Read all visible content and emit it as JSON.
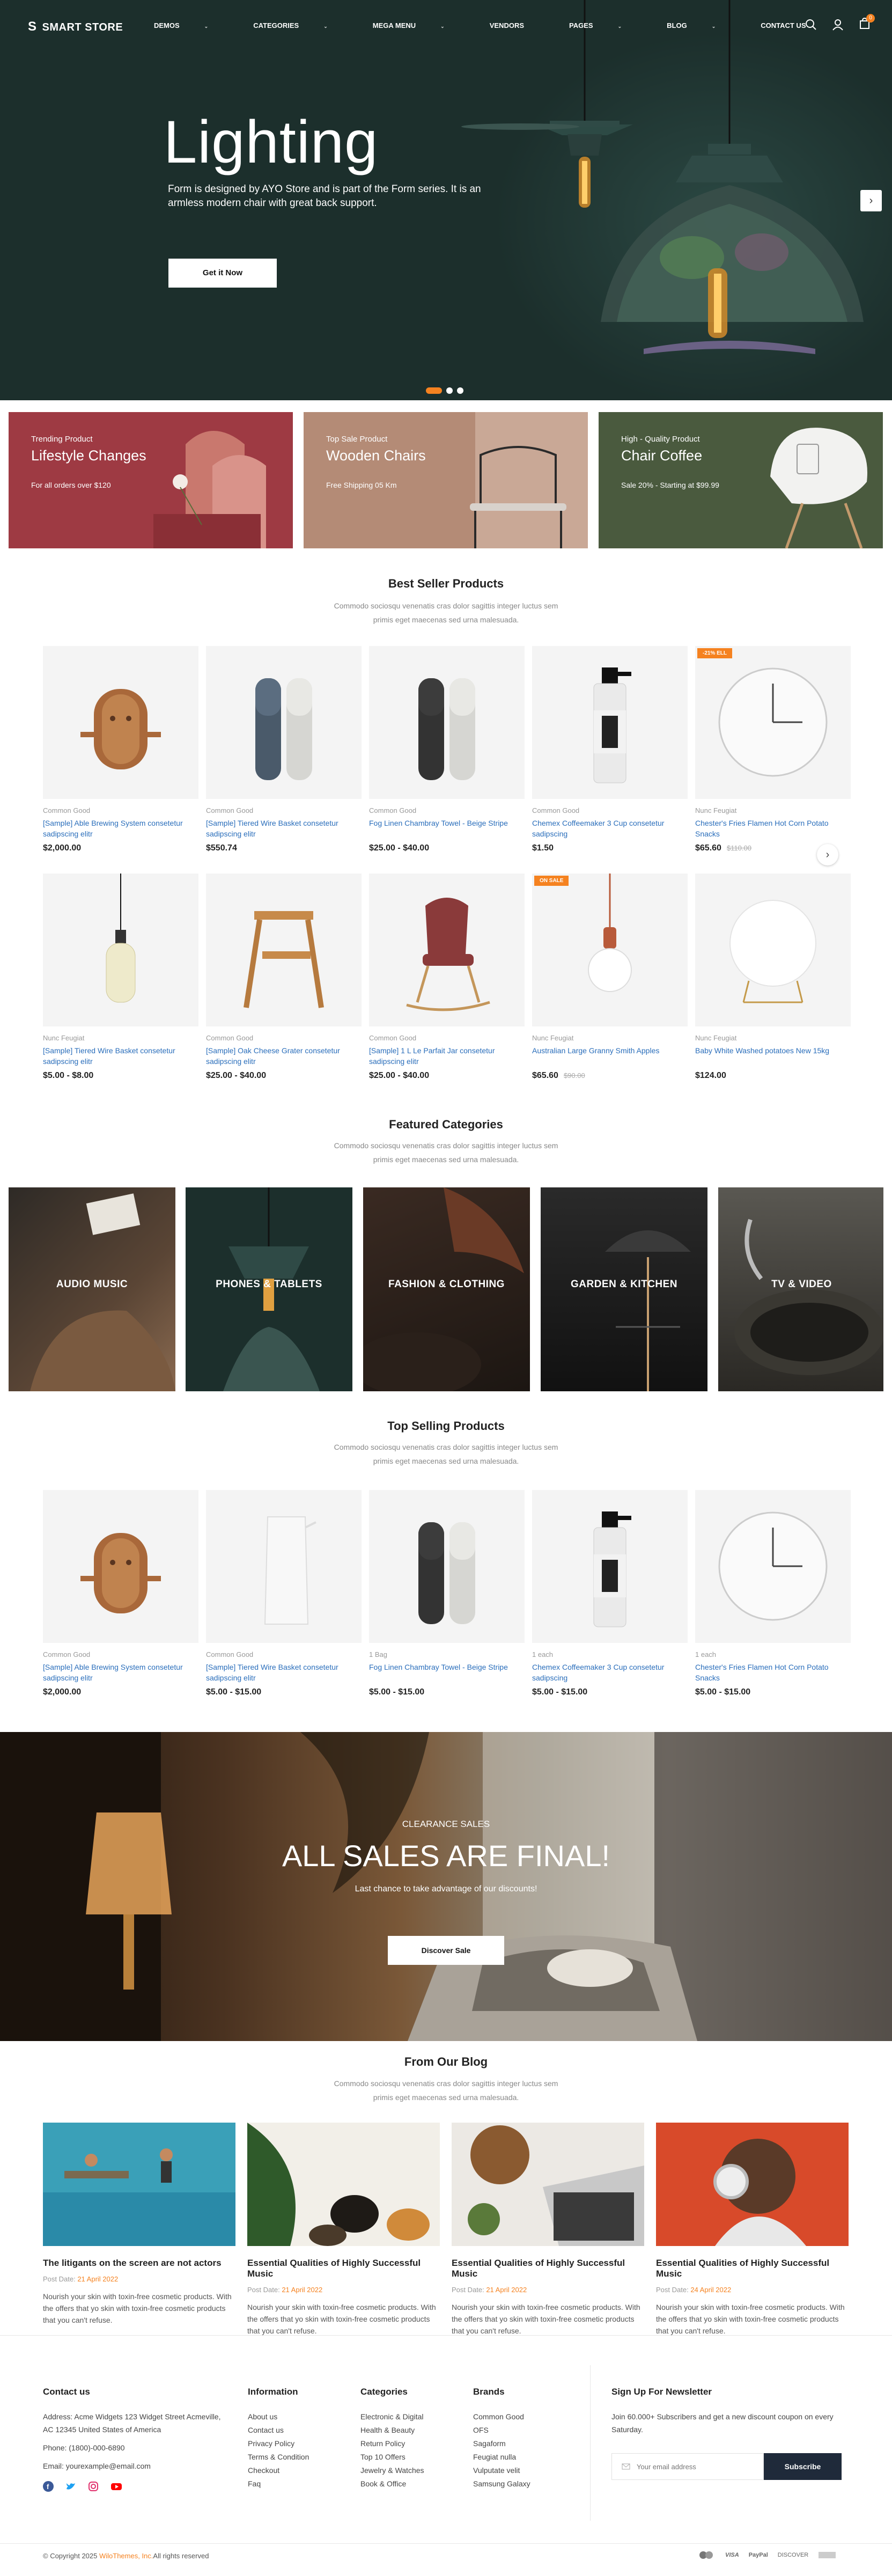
{
  "header": {
    "logo": "SMART STORE",
    "menu": [
      "DEMOS",
      "CATEGORIES",
      "MEGA MENU",
      "VENDORS",
      "PAGES",
      "BLOG",
      "CONTACT US"
    ],
    "cart_count": "0"
  },
  "hero": {
    "title": "Lighting",
    "description": "Form is designed by AYO Store and is part of the Form series. It is an armless modern chair with great back support.",
    "button": "Get it Now"
  },
  "promos": [
    {
      "sub": "Trending Product",
      "title": "Lifestyle Changes",
      "info": "For all orders over $120"
    },
    {
      "sub": "Top Sale Product",
      "title": "Wooden Chairs",
      "info": "Free Shipping 05 Km"
    },
    {
      "sub": "High - Quality Product",
      "title": "Chair Coffee",
      "info": "Sale 20% - Starting at $99.99"
    }
  ],
  "best_seller": {
    "title": "Best Seller Products",
    "desc": [
      "Commodo sociosqu venenatis cras dolor sagittis integer luctus sem",
      "primis eget maecenas sed urna malesuada."
    ],
    "products": [
      {
        "brand": "Common Good",
        "name": "[Sample] Able Brewing System consetetur sadipscing elitr",
        "price": "$2,000.00",
        "old": ""
      },
      {
        "brand": "Common Good",
        "name": "[Sample] Tiered Wire Basket consetetur sadipscing elitr",
        "price": "$550.74",
        "old": ""
      },
      {
        "brand": "Common Good",
        "name": "Fog Linen Chambray Towel - Beige Stripe",
        "price": "$25.00 - $40.00",
        "old": ""
      },
      {
        "brand": "Common Good",
        "name": "Chemex Coffeemaker 3 Cup consetetur sadipscing",
        "price": "$1.50",
        "old": ""
      },
      {
        "brand": "Nunc Feugiat",
        "name": "Chester's Fries Flamen Hot Corn Potato Snacks",
        "price": "$65.60",
        "old": "$110.00",
        "badge": "-21% ELL"
      },
      {
        "brand": "Nunc Feugiat",
        "name": "[Sample] Tiered Wire Basket consetetur sadipscing elitr",
        "price": "$5.00 - $8.00",
        "old": ""
      },
      {
        "brand": "Common Good",
        "name": "[Sample] Oak Cheese Grater consetetur sadipscing elitr",
        "price": "$25.00 - $40.00",
        "old": ""
      },
      {
        "brand": "Common Good",
        "name": "[Sample] 1 L Le Parfait Jar consetetur sadipscing elitr",
        "price": "$25.00 - $40.00",
        "old": ""
      },
      {
        "brand": "Nunc Feugiat",
        "name": "Australian Large Granny Smith Apples",
        "price": "$65.60",
        "old": "$90.00",
        "badge": "ON SALE"
      },
      {
        "brand": "Nunc Feugiat",
        "name": "Baby White Washed potatoes New 15kg",
        "price": "$124.00",
        "old": ""
      }
    ]
  },
  "featured": {
    "title": "Featured Categories",
    "desc": [
      "Commodo sociosqu venenatis cras dolor sagittis integer luctus sem",
      "primis eget maecenas sed urna malesuada."
    ],
    "categories": [
      "AUDIO MUSIC",
      "PHONES & TABLETS",
      "FASHION & CLOTHING",
      "GARDEN & KITCHEN",
      "TV & VIDEO"
    ]
  },
  "top_selling": {
    "title": "Top Selling Products",
    "desc": [
      "Commodo sociosqu venenatis cras dolor sagittis integer luctus sem",
      "primis eget maecenas sed urna malesuada."
    ],
    "products": [
      {
        "brand": "Common Good",
        "name": "[Sample] Able Brewing System consetetur sadipscing elitr",
        "price": "$2,000.00"
      },
      {
        "brand": "Common Good",
        "name": "[Sample] Tiered Wire Basket consetetur sadipscing elitr",
        "price": "$5.00 - $15.00"
      },
      {
        "brand": "1 Bag",
        "name": "Fog Linen Chambray Towel - Beige Stripe",
        "price": "$5.00 - $15.00"
      },
      {
        "brand": "1 each",
        "name": "Chemex Coffeemaker 3 Cup consetetur sadipscing",
        "price": "$5.00 - $15.00"
      },
      {
        "brand": "1 each",
        "name": "Chester's Fries Flamen Hot Corn Potato Snacks",
        "price": "$5.00 - $15.00"
      }
    ]
  },
  "clearance": {
    "sub": "CLEARANCE SALES",
    "title": "ALL SALES ARE FINAL!",
    "desc": "Last chance to take advantage of our discounts!",
    "button": "Discover Sale"
  },
  "blog": {
    "title": "From Our Blog",
    "desc": [
      "Commodo sociosqu venenatis cras dolor sagittis integer luctus sem",
      "primis eget maecenas sed urna malesuada."
    ],
    "posts": [
      {
        "title": "The litigants on the screen are not actors",
        "date_label": "Post Date:",
        "date": "21 April 2022"
      },
      {
        "title": "Essential Qualities of Highly Successful Music",
        "date_label": "Post Date:",
        "date": "21 April 2022"
      },
      {
        "title": "Essential Qualities of Highly Successful Music",
        "date_label": "Post Date:",
        "date": "21 April 2022"
      },
      {
        "title": "Essential Qualities of Highly Successful Music",
        "date_label": "Post Date:",
        "date": "24 April 2022"
      }
    ],
    "excerpt": "Nourish your skin with toxin-free cosmetic products. With the offers that yo skin with toxin-free cosmetic products that you can't refuse."
  },
  "footer": {
    "contact": {
      "title": "Contact us",
      "address": "Address: Acme Widgets 123 Widget Street Acmeville, AC 12345 United States of America",
      "phone": "Phone: (1800)-000-6890",
      "email": "Email: yourexample@email.com"
    },
    "information": {
      "title": "Information",
      "links": [
        "About us",
        "Contact us",
        "Privacy Policy",
        "Terms & Condition",
        "Checkout",
        "Faq"
      ]
    },
    "categories": {
      "title": "Categories",
      "links": [
        "Electronic & Digital",
        "Health & Beauty",
        "Return Policy",
        "Top 10 Offers",
        "Jewelry & Watches",
        "Book & Office"
      ]
    },
    "brands": {
      "title": "Brands",
      "links": [
        "Common Good",
        "OFS",
        "Sagaform",
        "Feugiat nulla",
        "Vulputate velit",
        "Samsung Galaxy"
      ]
    },
    "newsletter": {
      "title": "Sign Up For Newsletter",
      "desc": "Join 60.000+ Subscribers and get a new discount coupon on every Saturday.",
      "placeholder": "Your email address",
      "button": "Subscribe"
    },
    "copyright_pre": "© Copyright 2025",
    "copyright_brand": "WiloThemes, Inc.",
    "copyright_post": "All rights reserved",
    "payments": [
      "VISA",
      "PayPal",
      "DISCOVER"
    ]
  },
  "colors": {
    "accent": "#f58220",
    "link": "#2a6ebb",
    "hero_bg": "#1c2f2c",
    "dark_button": "#1f2a3a"
  }
}
